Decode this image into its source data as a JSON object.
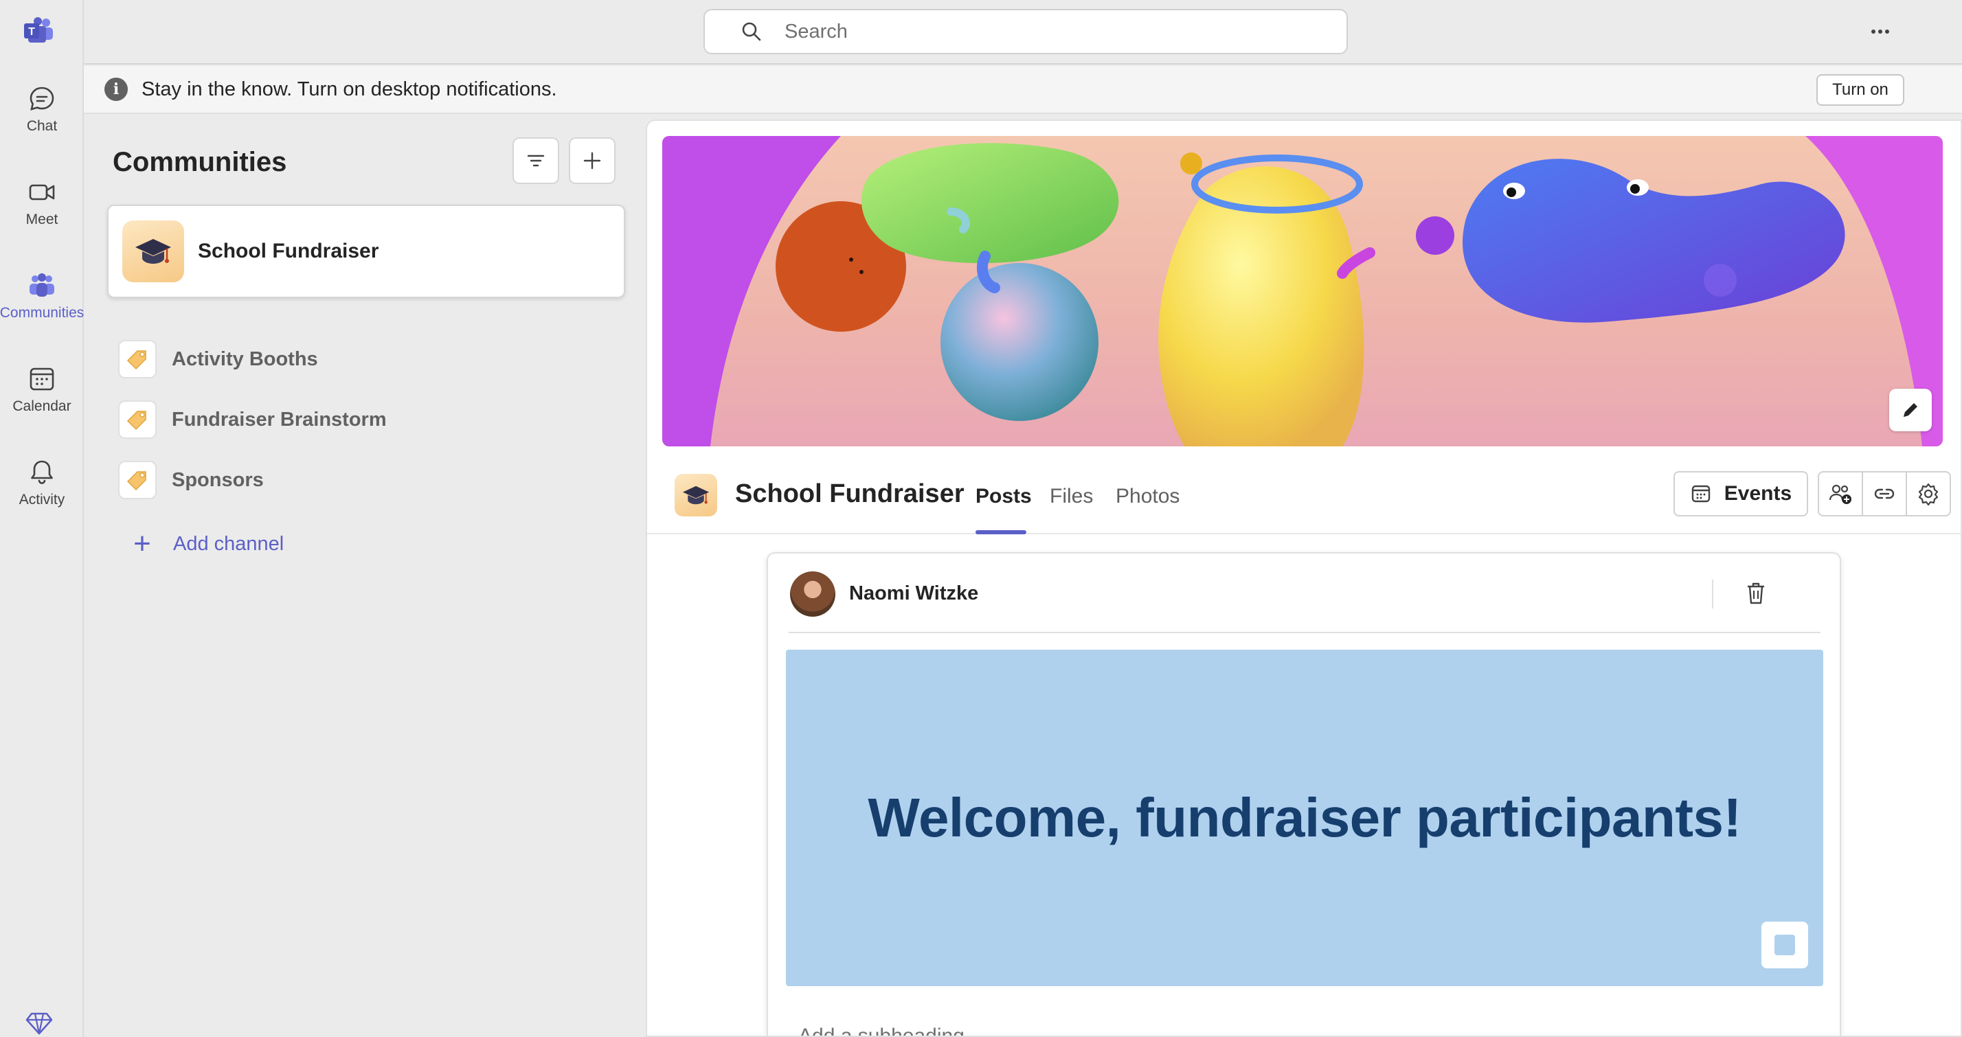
{
  "rail": {
    "items": [
      {
        "label": "Chat",
        "icon": "chat-icon"
      },
      {
        "label": "Meet",
        "icon": "video-icon"
      },
      {
        "label": "Communities",
        "icon": "communities-icon",
        "active": true
      },
      {
        "label": "Calendar",
        "icon": "calendar-icon"
      },
      {
        "label": "Activity",
        "icon": "bell-icon"
      }
    ]
  },
  "search": {
    "placeholder": "Search"
  },
  "banner": {
    "message": "Stay in the know. Turn on desktop notifications.",
    "button": "Turn on"
  },
  "panel": {
    "title": "Communities",
    "community": {
      "name": "School Fundraiser"
    },
    "channels": [
      {
        "name": "Activity Booths"
      },
      {
        "name": "Fundraiser Brainstorm"
      },
      {
        "name": "Sponsors"
      }
    ],
    "add_channel": "Add channel"
  },
  "channel_header": {
    "title": "School Fundraiser",
    "tabs": [
      {
        "label": "Posts",
        "active": true
      },
      {
        "label": "Files"
      },
      {
        "label": "Photos"
      }
    ],
    "events_label": "Events"
  },
  "post": {
    "author": "Naomi Witzke",
    "headline": "Welcome, fundraiser participants!",
    "subheading_placeholder": "Add a subheading"
  },
  "colors": {
    "accent": "#5b5fc7",
    "banner_bg": "#b0d1ee",
    "headline": "#163f6e"
  }
}
